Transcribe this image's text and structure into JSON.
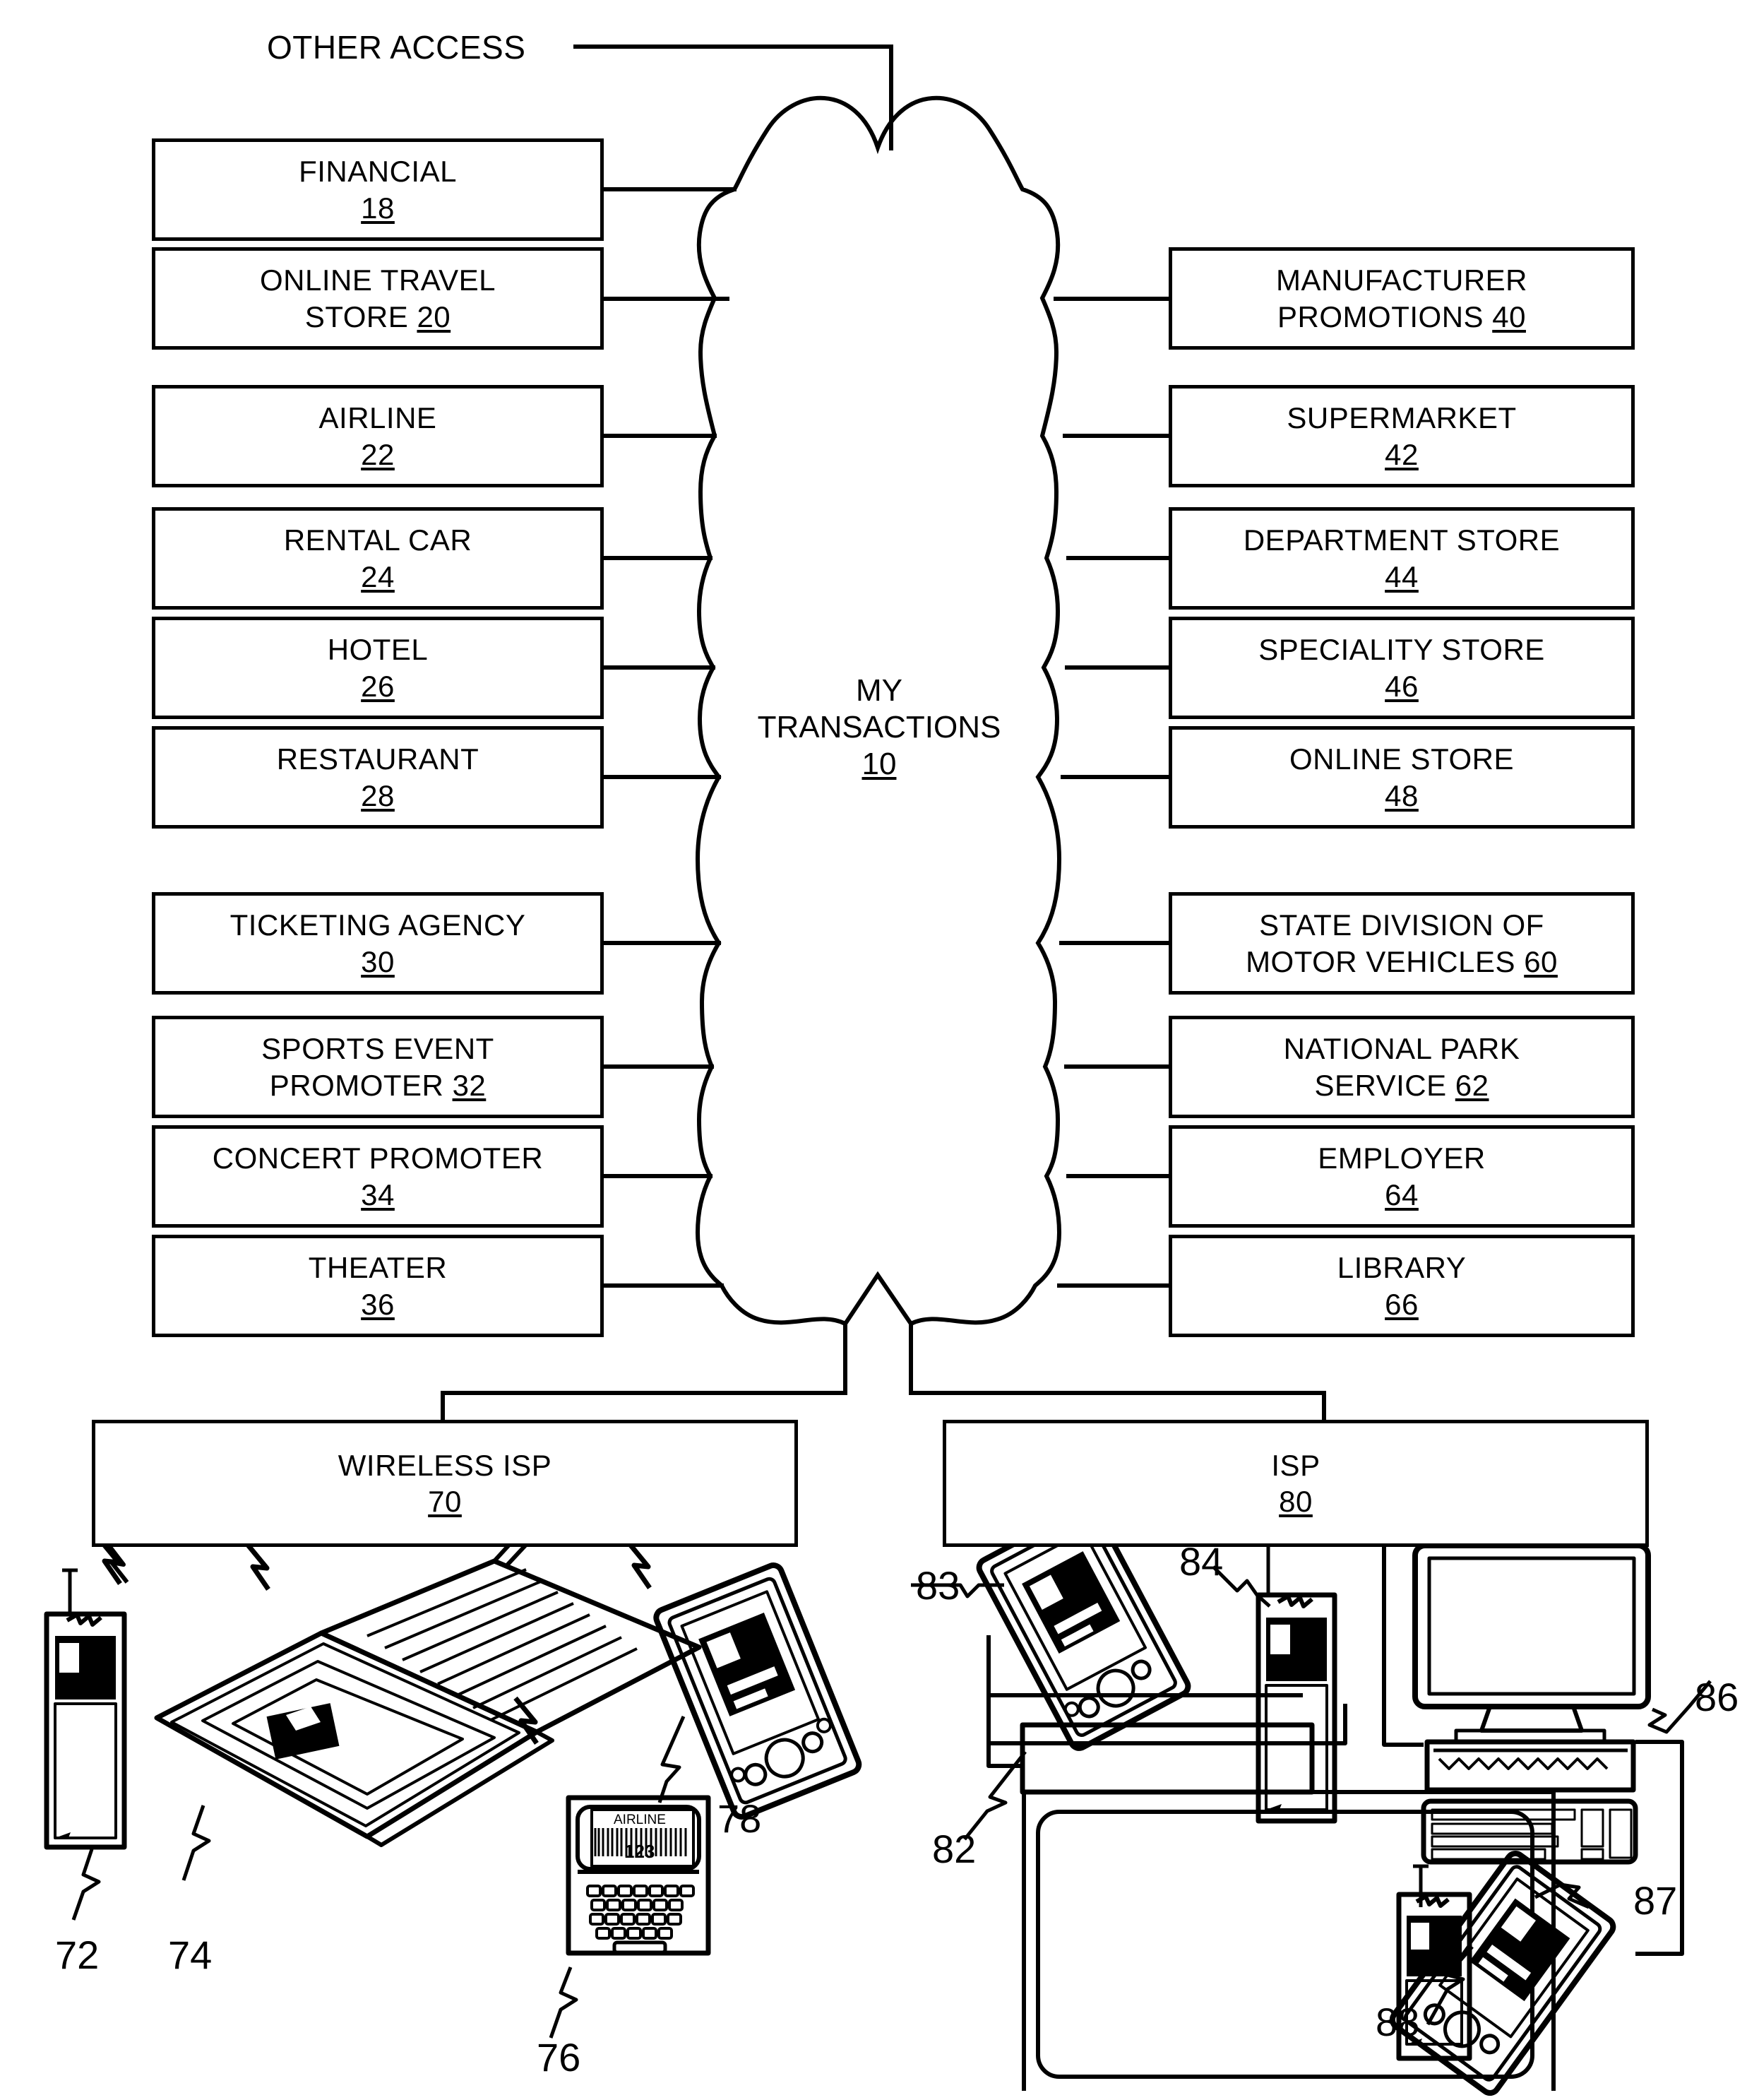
{
  "figure": {
    "other_access_label": "OTHER ACCESS",
    "hub": {
      "line1": "MY",
      "line2": "TRANSACTIONS",
      "ref": "10"
    }
  },
  "left_nodes": [
    {
      "line1": "FINANCIAL",
      "line2": "",
      "ref": "18",
      "ref_inline": false
    },
    {
      "line1": "ONLINE TRAVEL",
      "line2": "STORE",
      "ref": "20",
      "ref_inline": true
    },
    {
      "line1": "AIRLINE",
      "line2": "",
      "ref": "22",
      "ref_inline": false
    },
    {
      "line1": "RENTAL CAR",
      "line2": "",
      "ref": "24",
      "ref_inline": false
    },
    {
      "line1": "HOTEL",
      "line2": "",
      "ref": "26",
      "ref_inline": false
    },
    {
      "line1": "RESTAURANT",
      "line2": "",
      "ref": "28",
      "ref_inline": false
    },
    {
      "line1": "TICKETING AGENCY",
      "line2": "",
      "ref": "30",
      "ref_inline": false
    },
    {
      "line1": "SPORTS EVENT",
      "line2": "PROMOTER",
      "ref": "32",
      "ref_inline": true
    },
    {
      "line1": "CONCERT PROMOTER",
      "line2": "",
      "ref": "34",
      "ref_inline": false
    },
    {
      "line1": "THEATER",
      "line2": "",
      "ref": "36",
      "ref_inline": false
    }
  ],
  "right_nodes": [
    {
      "line1": "MANUFACTURER",
      "line2": "PROMOTIONS",
      "ref": "40",
      "ref_inline": true
    },
    {
      "line1": "SUPERMARKET",
      "line2": "",
      "ref": "42",
      "ref_inline": false
    },
    {
      "line1": "DEPARTMENT STORE",
      "line2": "",
      "ref": "44",
      "ref_inline": false
    },
    {
      "line1": "SPECIALITY STORE",
      "line2": "",
      "ref": "46",
      "ref_inline": false
    },
    {
      "line1": "ONLINE STORE",
      "line2": "",
      "ref": "48",
      "ref_inline": false
    },
    {
      "line1": "STATE DIVISION OF",
      "line2": "MOTOR VEHICLES",
      "ref": "60",
      "ref_inline": true
    },
    {
      "line1": "NATIONAL PARK",
      "line2": "SERVICE",
      "ref": "62",
      "ref_inline": true
    },
    {
      "line1": "EMPLOYER",
      "line2": "",
      "ref": "64",
      "ref_inline": false
    },
    {
      "line1": "LIBRARY",
      "line2": "",
      "ref": "66",
      "ref_inline": false
    }
  ],
  "isp_nodes": [
    {
      "line1": "WIRELESS ISP",
      "ref": "70"
    },
    {
      "line1": "ISP",
      "ref": "80"
    }
  ],
  "devices": [
    {
      "ref": "72",
      "name": "wireless-phone"
    },
    {
      "ref": "74",
      "name": "wireless-tablet-folio"
    },
    {
      "ref": "76",
      "name": "wireless-laptop"
    },
    {
      "ref": "78",
      "name": "wireless-pda"
    },
    {
      "ref": "82",
      "name": "set-top-box"
    },
    {
      "ref": "83",
      "name": "docked-pda"
    },
    {
      "ref": "84",
      "name": "docked-phone"
    },
    {
      "ref": "86",
      "name": "desktop-computer"
    },
    {
      "ref": "87",
      "name": "desk-pda"
    },
    {
      "ref": "88",
      "name": "desk-phone"
    }
  ],
  "laptop_screen": {
    "title": "AIRLINE",
    "code": "123"
  }
}
